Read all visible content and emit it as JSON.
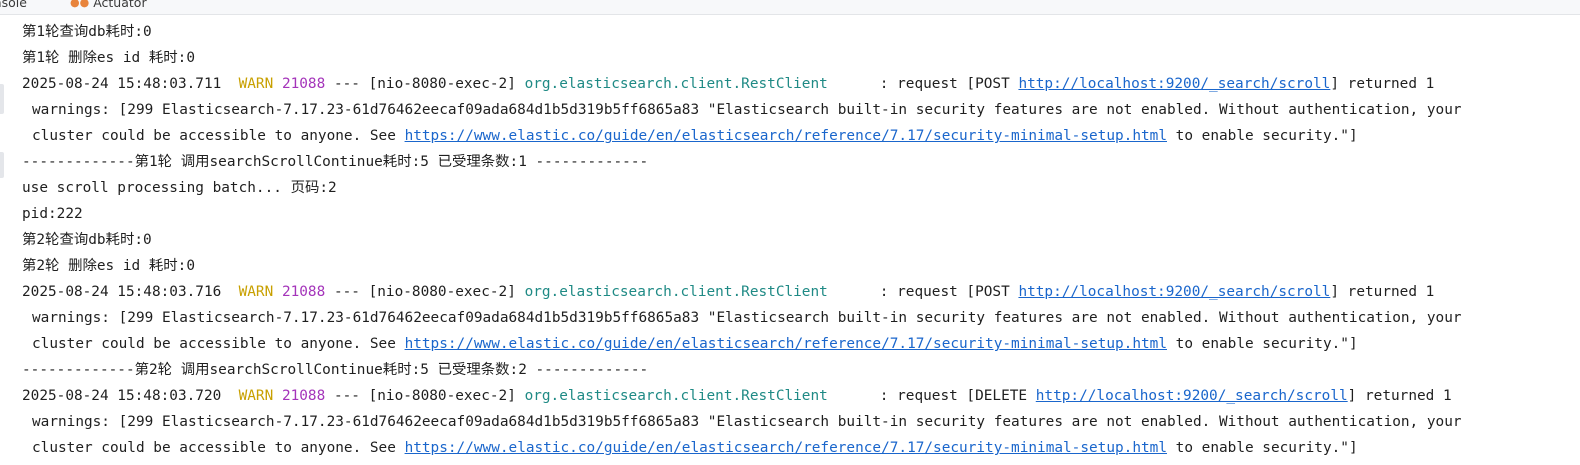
{
  "tabs": {
    "console": "onsole",
    "actuator": "Actuator"
  },
  "colors": {
    "warn": "#c8a000",
    "pid": "#a434ba",
    "logger": "#1f8a85",
    "link": "#1a66cc"
  },
  "log": {
    "l1": "第1轮查询db耗时:0",
    "l2": "第1轮 删除es id 耗时:0",
    "warn1": {
      "ts": "2025-08-24 15:48:03.711",
      "level": "WARN",
      "pid": "21088",
      "thread": "--- [nio-8080-exec-2]",
      "logger": "org.elasticsearch.client.RestClient",
      "msg_pre": ": request [POST",
      "url": "http://localhost:9200/_search/scroll",
      "msg_post": "] returned 1"
    },
    "warn1_cont1": "warnings: [299 Elasticsearch-7.17.23-61d76462eecaf09ada684d1b5d319b5ff6865a83 \"Elasticsearch built-in security features are not enabled. Without authentication, your",
    "warn1_cont2_pre": "cluster could be accessible to anyone. See",
    "warn1_cont2_link": "https://www.elastic.co/guide/en/elasticsearch/reference/7.17/security-minimal-setup.html",
    "warn1_cont2_post": "to enable security.\"]",
    "l3": "-------------第1轮 调用searchScrollContinue耗时:5 已受理条数:1 -------------",
    "l4": "use scroll processing batch... 页码:2",
    "l5": "pid:222",
    "l6": "第2轮查询db耗时:0",
    "l7": "第2轮 删除es id 耗时:0",
    "warn2": {
      "ts": "2025-08-24 15:48:03.716",
      "level": "WARN",
      "pid": "21088",
      "thread": "--- [nio-8080-exec-2]",
      "logger": "org.elasticsearch.client.RestClient",
      "msg_pre": ": request [POST",
      "url": "http://localhost:9200/_search/scroll",
      "msg_post": "] returned 1"
    },
    "warn2_cont1": "warnings: [299 Elasticsearch-7.17.23-61d76462eecaf09ada684d1b5d319b5ff6865a83 \"Elasticsearch built-in security features are not enabled. Without authentication, your",
    "warn2_cont2_pre": "cluster could be accessible to anyone. See",
    "warn2_cont2_link": "https://www.elastic.co/guide/en/elasticsearch/reference/7.17/security-minimal-setup.html",
    "warn2_cont2_post": "to enable security.\"]",
    "l8": "-------------第2轮 调用searchScrollContinue耗时:5 已受理条数:2 -------------",
    "warn3": {
      "ts": "2025-08-24 15:48:03.720",
      "level": "WARN",
      "pid": "21088",
      "thread": "--- [nio-8080-exec-2]",
      "logger": "org.elasticsearch.client.RestClient",
      "msg_pre": ": request [DELETE",
      "url": "http://localhost:9200/_search/scroll",
      "msg_post": "] returned 1"
    },
    "warn3_cont1": "warnings: [299 Elasticsearch-7.17.23-61d76462eecaf09ada684d1b5d319b5ff6865a83 \"Elasticsearch built-in security features are not enabled. Without authentication, your",
    "warn3_cont2_pre": "cluster could be accessible to anyone. See",
    "warn3_cont2_link": "https://www.elastic.co/guide/en/elasticsearch/reference/7.17/security-minimal-setup.html",
    "warn3_cont2_post": "to enable security.\"]"
  }
}
